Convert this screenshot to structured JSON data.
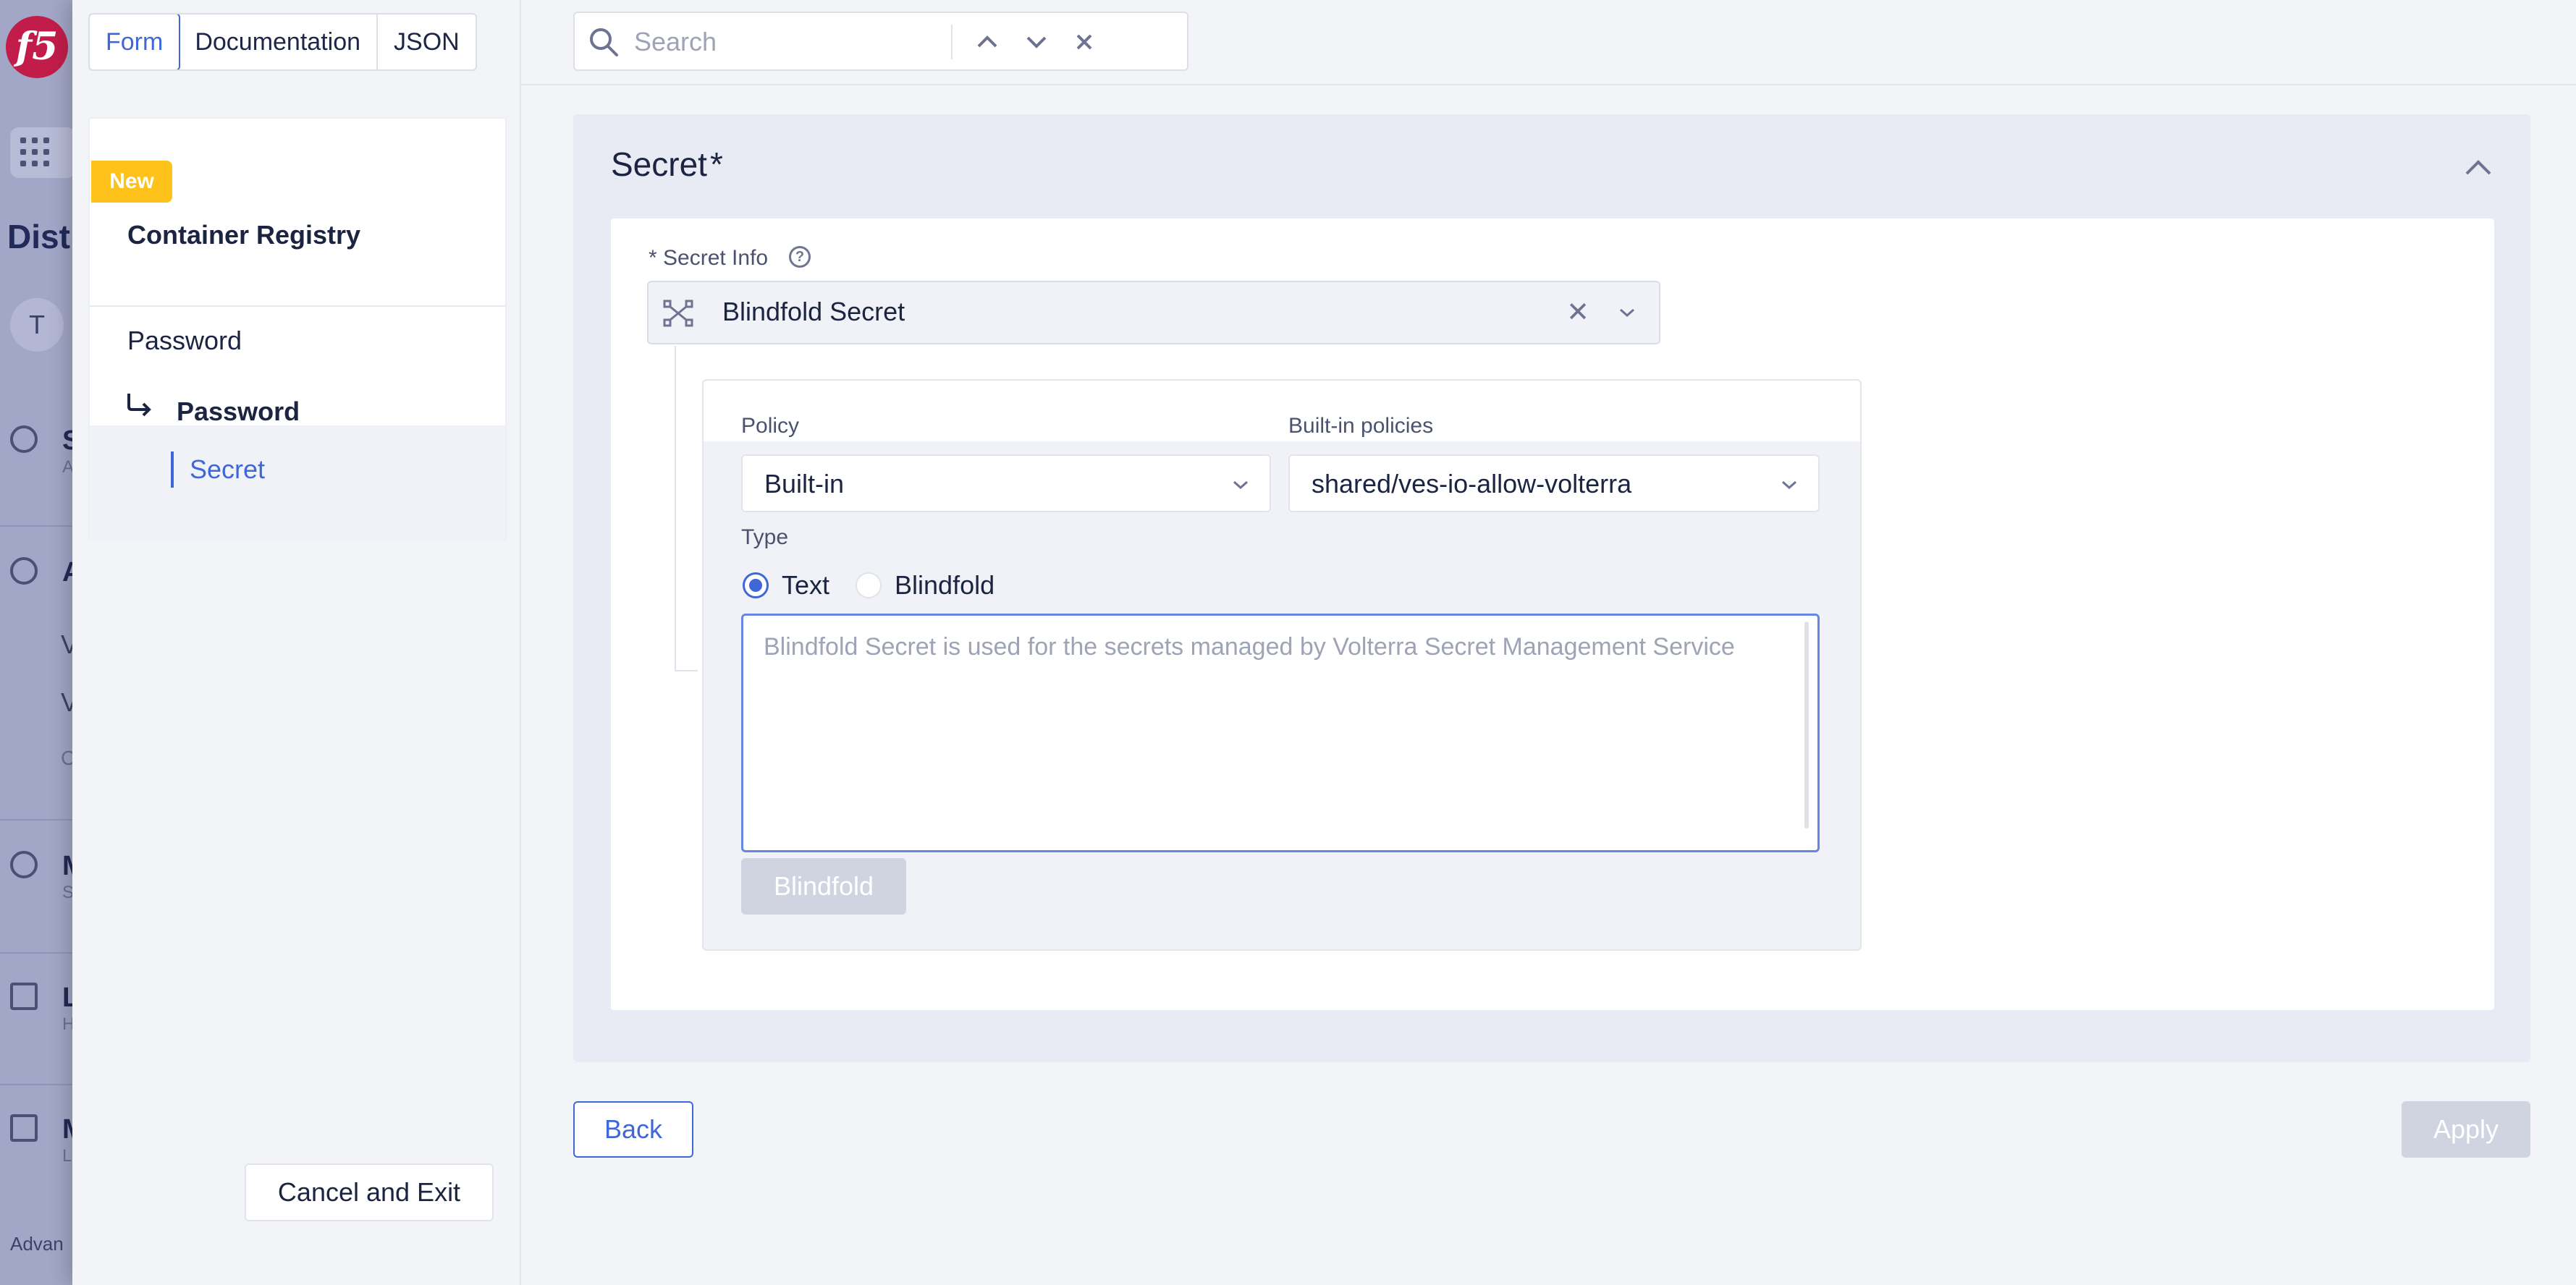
{
  "background_app": {
    "logo_text": "f5",
    "title_fragment": "Dist",
    "avatar_initial": "T",
    "rows": [
      {
        "title": "S",
        "sub": "A"
      },
      {
        "title": "A",
        "sub": ""
      },
      {
        "title": "M",
        "sub": "S"
      },
      {
        "title": "L",
        "sub": "H"
      },
      {
        "title": "M",
        "sub": "L"
      }
    ],
    "sub_items": [
      "V",
      "V",
      "C"
    ],
    "bottom_text": "Advan"
  },
  "view_tabs": [
    "Form",
    "Documentation",
    "JSON"
  ],
  "active_view_tab": "Form",
  "sidebar_nav": {
    "badge": "New",
    "title": "Container Registry",
    "item_1": "Password",
    "item_2": "Password",
    "item_3": "Secret"
  },
  "cancel_label": "Cancel and Exit",
  "search": {
    "placeholder": "Search",
    "value": ""
  },
  "section": {
    "title": "Secret",
    "required_mark": "*",
    "secret_info_label": "* Secret Info",
    "secret_info_value": "Blindfold Secret",
    "policy_label": "Policy",
    "policy_value": "Built-in",
    "builtin_policies_label": "Built-in policies",
    "builtin_policies_value": "shared/ves-io-allow-volterra",
    "type_label": "Type",
    "type_options": [
      "Text",
      "Blindfold"
    ],
    "type_selected": "Text",
    "textarea_placeholder": "Blindfold Secret is used for the secrets managed by Volterra Secret Management Service",
    "textarea_value": "",
    "blindfold_button": "Blindfold"
  },
  "back_label": "Back",
  "apply_label": "Apply",
  "colors": {
    "accent": "#3f67d8",
    "badge": "#ffc21a",
    "disabled_button": "#d0d4e0",
    "section_bg": "#e8eaf4"
  },
  "icons": {
    "search": "search-icon",
    "prev": "chevron-up-icon",
    "next": "chevron-down-icon",
    "clear_search": "close-icon",
    "collapse": "chevron-up-icon",
    "secret_type": "blindfold-network-icon",
    "help": "question-circle-icon",
    "nav_arrow": "arrow-corner-right-icon"
  }
}
